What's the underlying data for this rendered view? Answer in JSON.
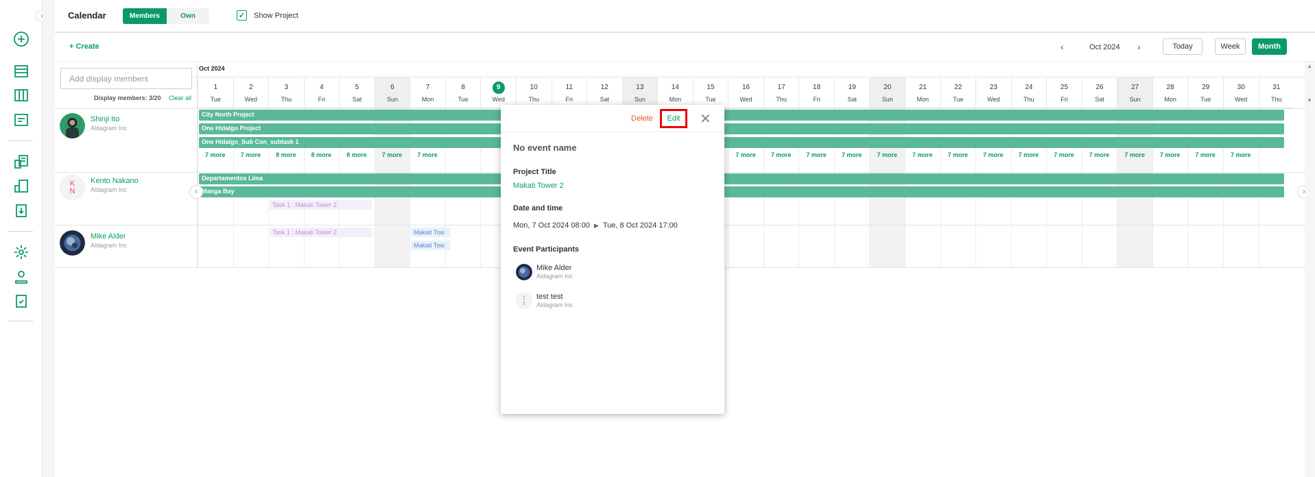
{
  "header": {
    "title": "Calendar",
    "members_tab": "Members",
    "own_tab": "Own",
    "show_project_label": "Show Project"
  },
  "toolbar": {
    "create_label": "Create",
    "month_label": "Oct 2024",
    "today": "Today",
    "week": "Week",
    "month": "Month"
  },
  "members_panel": {
    "search_placeholder": "Add display members",
    "display_count": "Display members: 3/20",
    "clear_all": "Clear all"
  },
  "calendar": {
    "month_header": "Oct 2024",
    "days": [
      {
        "n": "1",
        "w": "Tue"
      },
      {
        "n": "2",
        "w": "Wed"
      },
      {
        "n": "3",
        "w": "Thu"
      },
      {
        "n": "4",
        "w": "Fri"
      },
      {
        "n": "5",
        "w": "Sat"
      },
      {
        "n": "6",
        "w": "Sun"
      },
      {
        "n": "7",
        "w": "Mon"
      },
      {
        "n": "8",
        "w": "Tue"
      },
      {
        "n": "9",
        "w": "Wed"
      },
      {
        "n": "10",
        "w": "Thu"
      },
      {
        "n": "11",
        "w": "Fri"
      },
      {
        "n": "12",
        "w": "Sat"
      },
      {
        "n": "13",
        "w": "Sun"
      },
      {
        "n": "14",
        "w": "Mon"
      },
      {
        "n": "15",
        "w": "Tue"
      },
      {
        "n": "16",
        "w": "Wed"
      },
      {
        "n": "17",
        "w": "Thu"
      },
      {
        "n": "18",
        "w": "Fri"
      },
      {
        "n": "19",
        "w": "Sat"
      },
      {
        "n": "20",
        "w": "Sun"
      },
      {
        "n": "21",
        "w": "Mon"
      },
      {
        "n": "22",
        "w": "Tue"
      },
      {
        "n": "23",
        "w": "Wed"
      },
      {
        "n": "24",
        "w": "Thu"
      },
      {
        "n": "25",
        "w": "Fri"
      },
      {
        "n": "26",
        "w": "Sat"
      },
      {
        "n": "27",
        "w": "Sun"
      },
      {
        "n": "28",
        "w": "Mon"
      },
      {
        "n": "29",
        "w": "Tue"
      },
      {
        "n": "30",
        "w": "Wed"
      },
      {
        "n": "31",
        "w": "Thu"
      }
    ],
    "today": "9",
    "members": [
      {
        "name": "Shinji Ito",
        "org": "Aldagram Inc"
      },
      {
        "name": "Kento Nakano",
        "org": "Aldagram Inc",
        "initials": "K N"
      },
      {
        "name": "Mike Alder",
        "org": "Aldagram Inc"
      }
    ],
    "projects_row1": [
      "City North Project",
      "One Hidalgo Project",
      "One Hidalgo_Sub Con_subtask 1"
    ],
    "more_row1": [
      "7 more",
      "7 more",
      "8 more",
      "8 more",
      "8 more",
      "7 more",
      "7 more",
      "7 more",
      "7 more",
      "7 more",
      "7 more",
      "7 more",
      "7 more",
      "7 more",
      "7 more",
      "7 more",
      "7 more",
      "7 more",
      "7 more",
      "7 more",
      "7 more",
      "7 more",
      "7 more",
      "7 more"
    ],
    "projects_row2": [
      "Departamentos Lima",
      "Manga Bay"
    ],
    "task_row2": "Task 1 : Makati Tower 2",
    "task_row3": "Task 1 : Makati Tower 2",
    "task_row3b": "Makati Tow",
    "task_row3c": "Makati Tow"
  },
  "popup": {
    "delete": "Delete",
    "edit": "Edit",
    "event_name": "No event name",
    "project_title_label": "Project Title",
    "project_title": "Makati Tower 2",
    "datetime_label": "Date and time",
    "start": "Mon, 7 Oct 2024 08:00",
    "end": "Tue, 8 Oct 2024 17:00",
    "participants_label": "Event Participants",
    "participants": [
      {
        "name": "Mike Alder",
        "org": "Aldagram Inc"
      },
      {
        "name": "test test",
        "org": "Aldagram Inc",
        "initials": "t t"
      }
    ]
  },
  "colors": {
    "accent": "#0b9a66",
    "bar": "#5bb89a",
    "danger": "#e0582a"
  }
}
